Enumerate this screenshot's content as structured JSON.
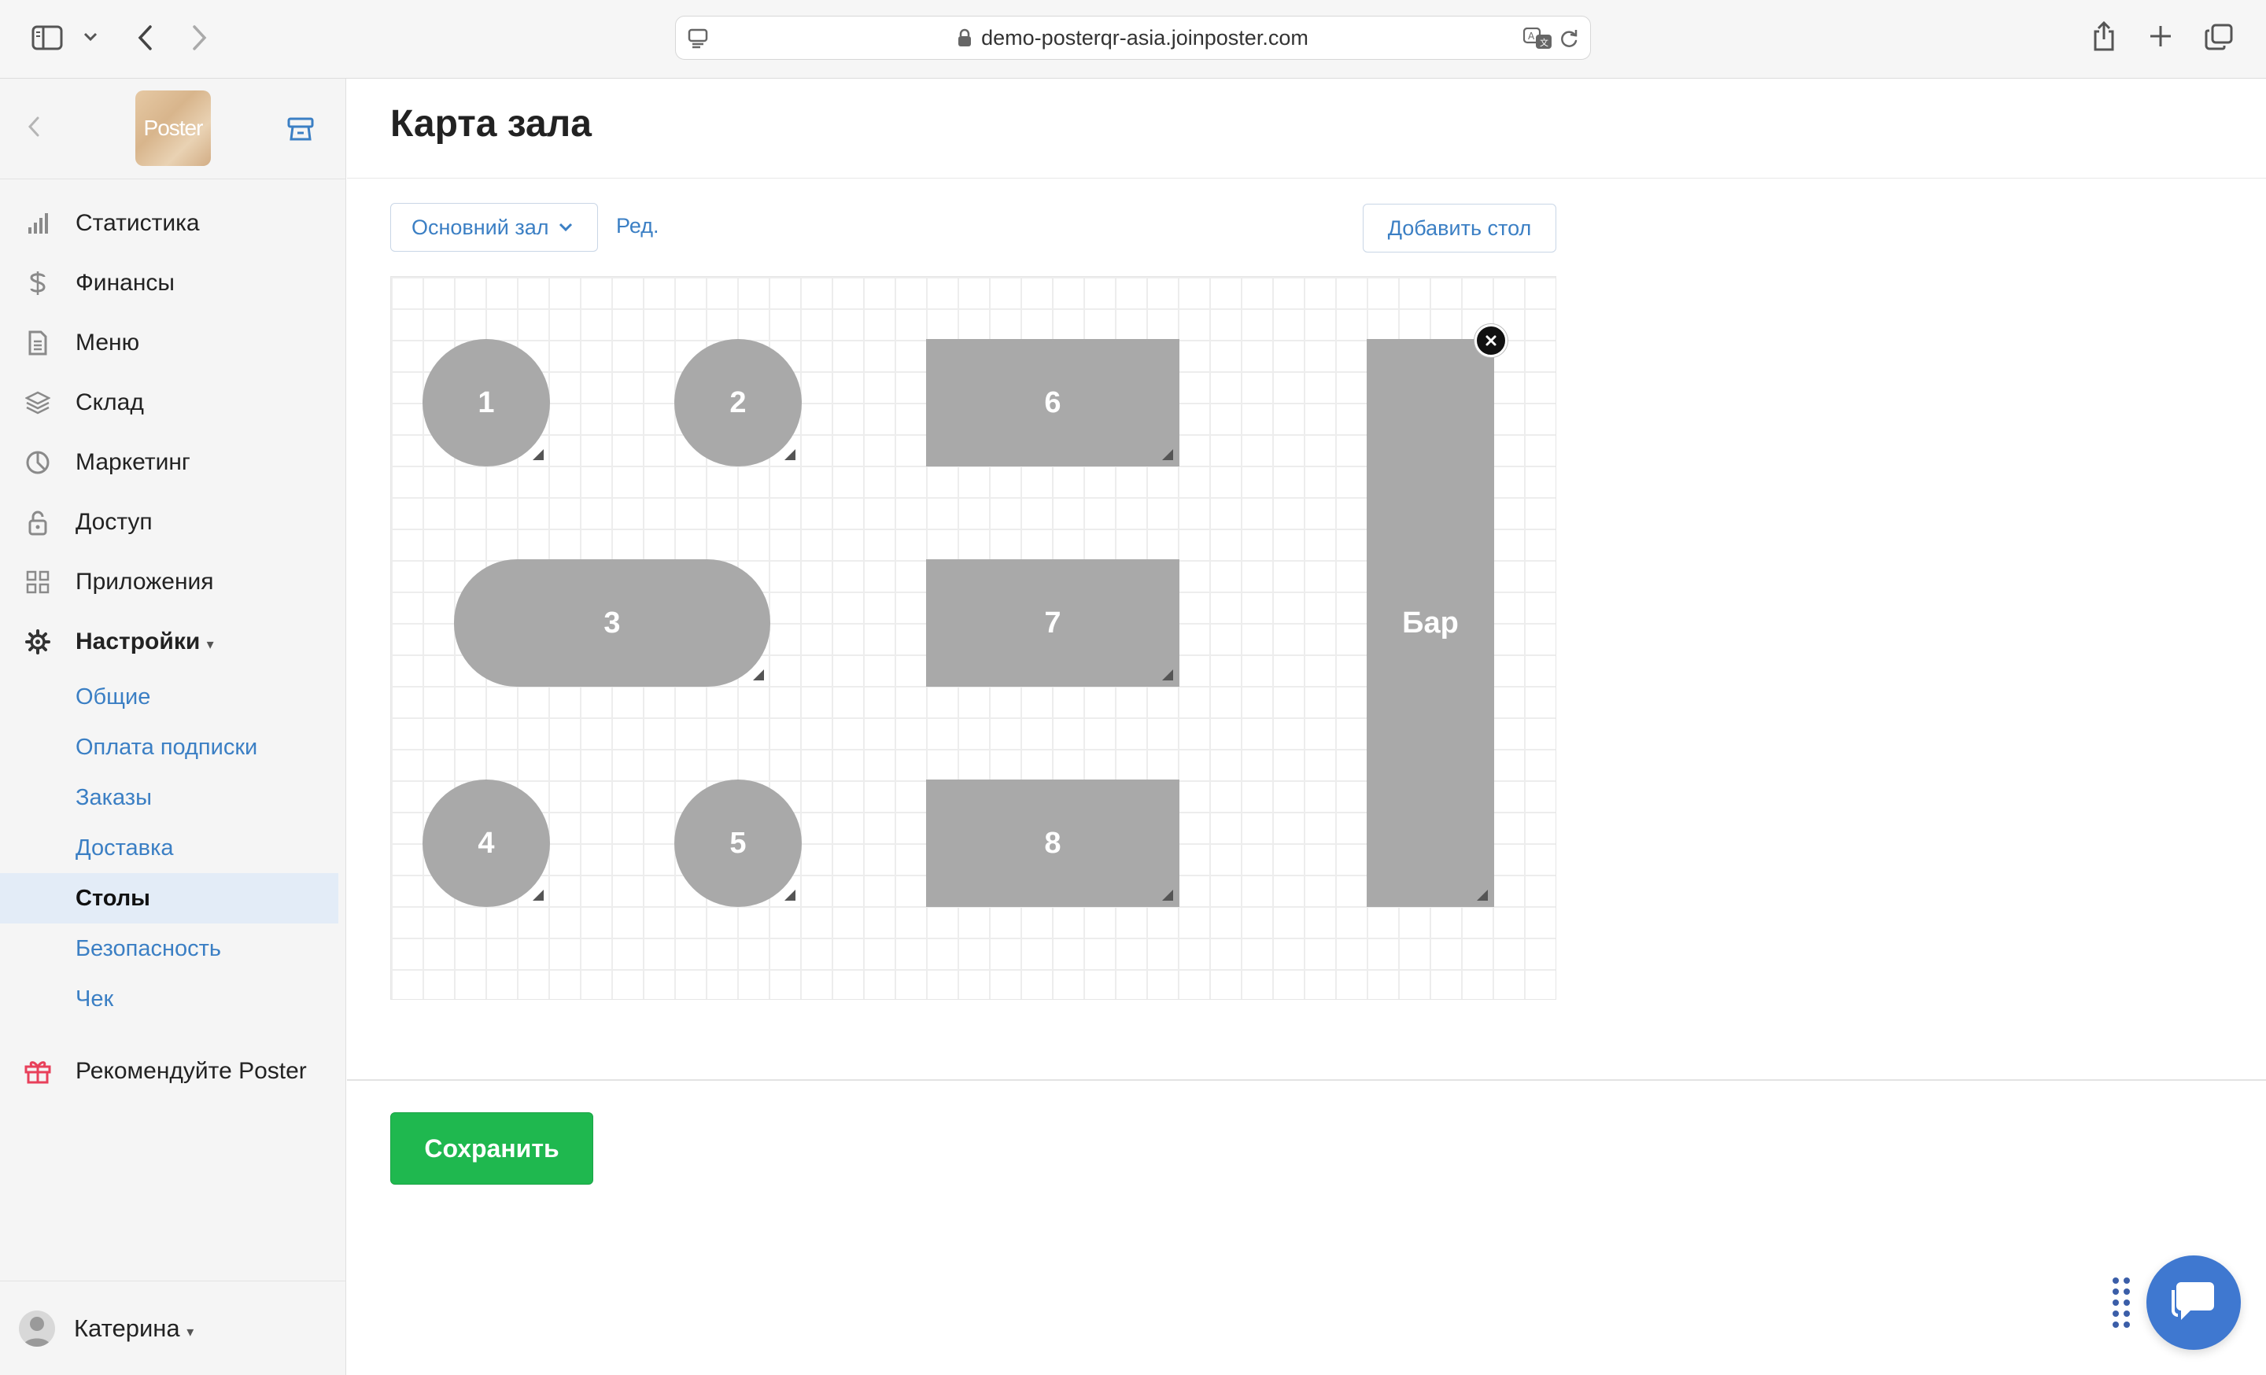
{
  "browser": {
    "url": "demo-posterqr-asia.joinposter.com"
  },
  "sidebar": {
    "logo_text": "Poster",
    "items": [
      {
        "label": "Статистика",
        "icon": "bar-chart-icon"
      },
      {
        "label": "Финансы",
        "icon": "dollar-icon"
      },
      {
        "label": "Меню",
        "icon": "document-icon"
      },
      {
        "label": "Склад",
        "icon": "layers-icon"
      },
      {
        "label": "Маркетинг",
        "icon": "pie-chart-icon"
      },
      {
        "label": "Доступ",
        "icon": "lock-icon"
      },
      {
        "label": "Приложения",
        "icon": "apps-grid-icon"
      },
      {
        "label": "Настройки",
        "icon": "gear-icon"
      }
    ],
    "settings_caret": "▾",
    "sub_items": [
      {
        "label": "Общие"
      },
      {
        "label": "Оплата подписки"
      },
      {
        "label": "Заказы"
      },
      {
        "label": "Доставка"
      },
      {
        "label": "Столы",
        "active": true
      },
      {
        "label": "Безопасность"
      },
      {
        "label": "Чек"
      }
    ],
    "recommend": {
      "label": "Рекомендуйте Poster",
      "icon": "gift-icon",
      "color": "#e8405a"
    },
    "user": {
      "name": "Катерина",
      "caret": "▾"
    }
  },
  "main": {
    "title": "Карта зала",
    "hall_select": {
      "value": "Основний зал"
    },
    "edit_label": "Ред.",
    "add_table_label": "Добавить стол",
    "save_label": "Сохранить",
    "tables": [
      {
        "label": "1"
      },
      {
        "label": "2"
      },
      {
        "label": "3"
      },
      {
        "label": "4"
      },
      {
        "label": "5"
      },
      {
        "label": "6"
      },
      {
        "label": "7"
      },
      {
        "label": "8"
      },
      {
        "label": "Бар"
      }
    ]
  },
  "colors": {
    "accent": "#3b7fc4",
    "save_green": "#1fb84f",
    "table_gray": "#a9a9a9",
    "chat_blue": "#3f78d0"
  }
}
